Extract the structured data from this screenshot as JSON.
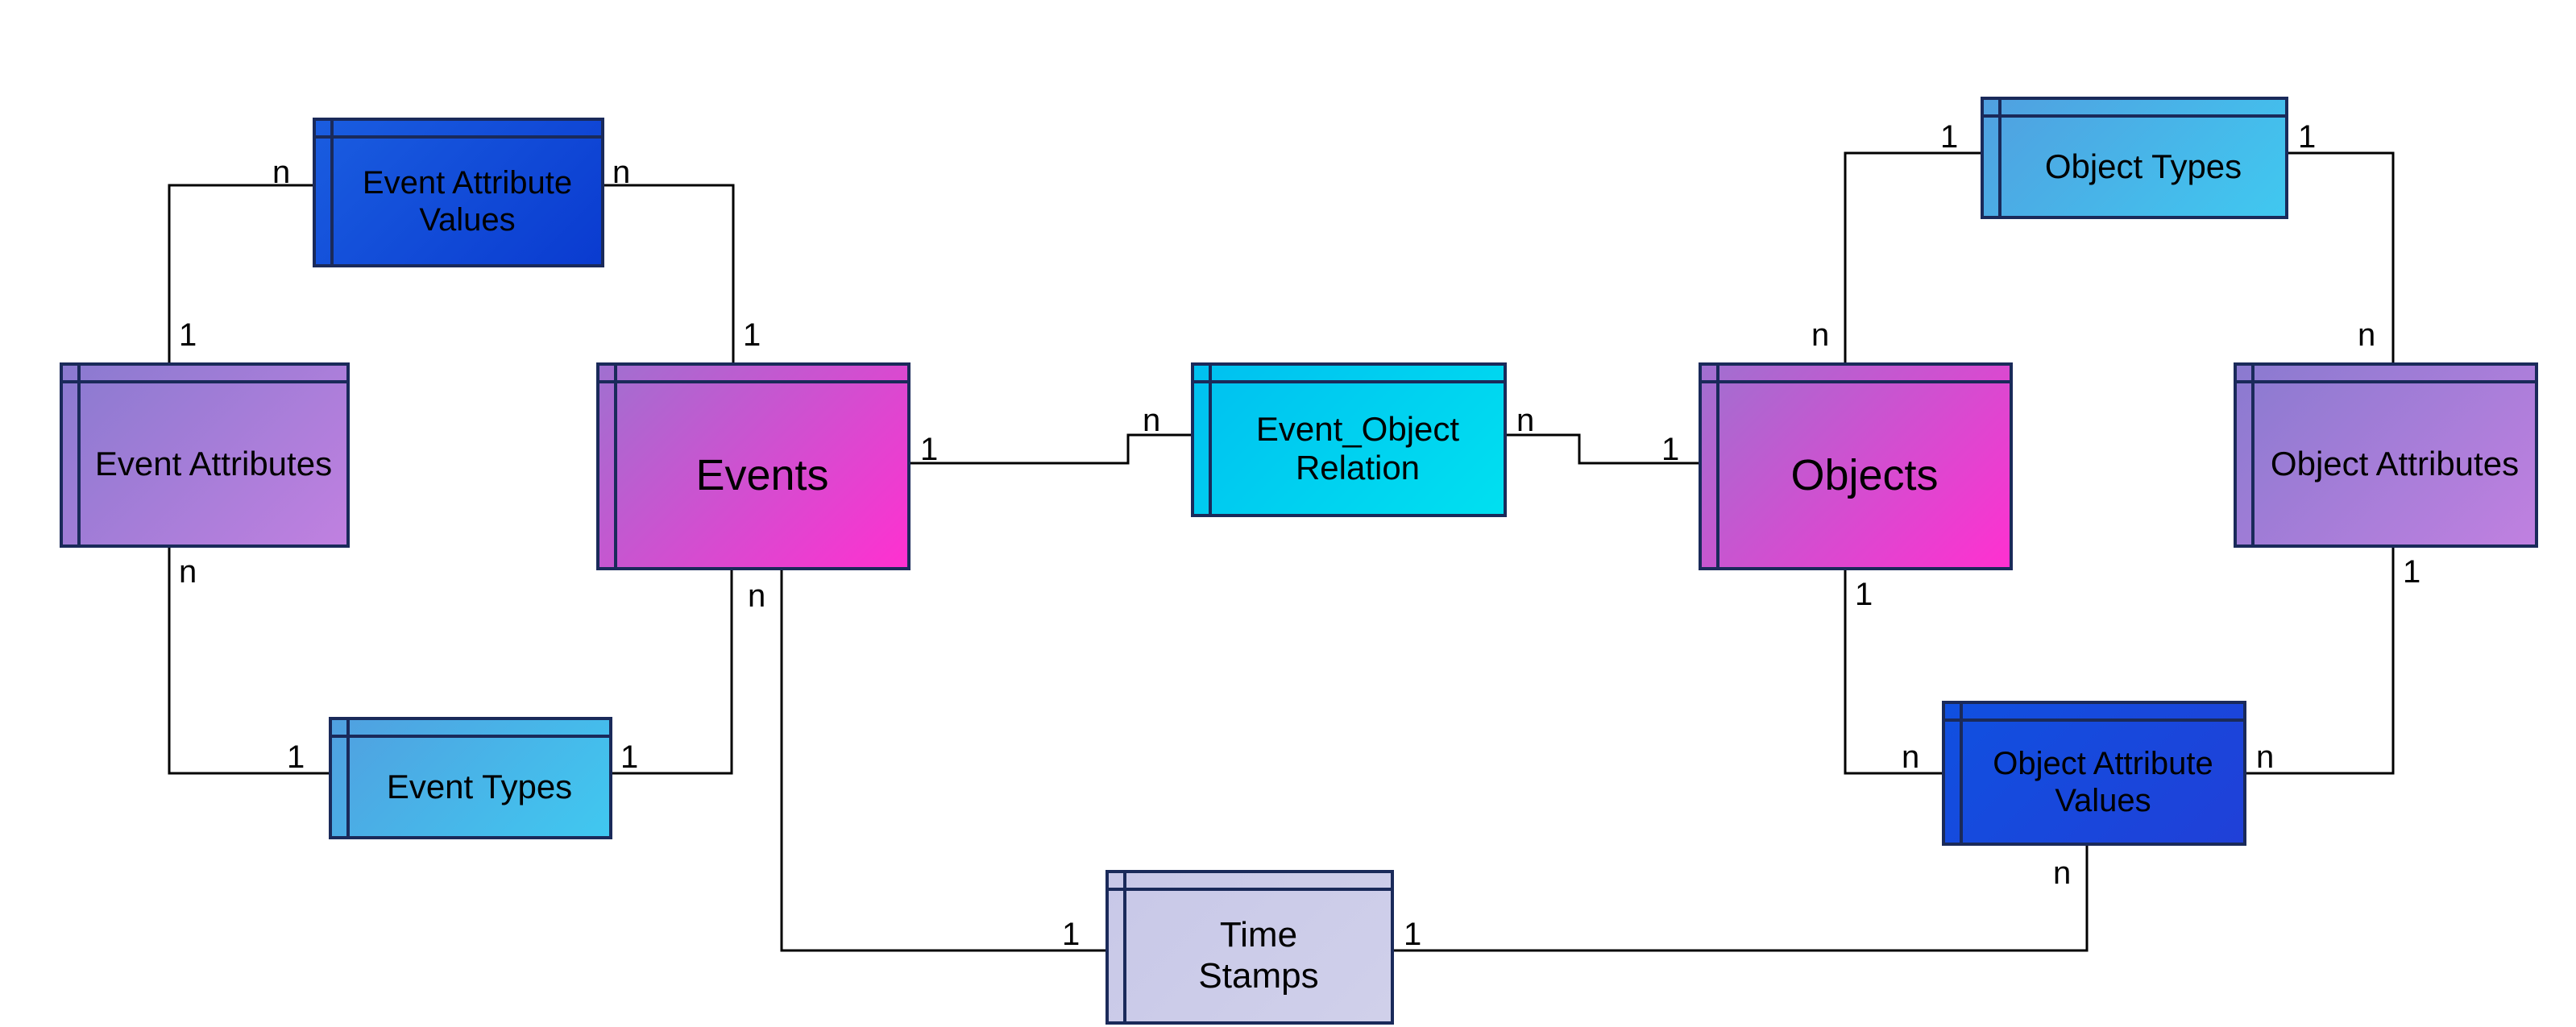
{
  "entities": {
    "event_attribute_values": {
      "label": "Event Attribute\nValues"
    },
    "event_attributes": {
      "label": "Event Attributes"
    },
    "events": {
      "label": "Events"
    },
    "event_types": {
      "label": "Event Types"
    },
    "event_object_relation": {
      "label": "Event_Object\nRelation"
    },
    "time_stamps": {
      "label": "Time\nStamps"
    },
    "objects": {
      "label": "Objects"
    },
    "object_types": {
      "label": "Object Types"
    },
    "object_attributes": {
      "label": "Object Attributes"
    },
    "object_attribute_values": {
      "label": "Object Attribute\nValues"
    }
  },
  "cardinalities": {
    "eav_left_n": "n",
    "eav_right_n": "n",
    "ea_top_1": "1",
    "ea_bottom_n": "n",
    "events_top_1": "1",
    "events_right_1": "1",
    "events_bottom_n": "n",
    "et_left_1": "1",
    "et_right_1": "1",
    "eor_left_n": "n",
    "eor_right_n": "n",
    "ts_left_1": "1",
    "ts_right_1": "1",
    "objects_left_1": "1",
    "objects_top_n": "n",
    "objects_bottom_1": "1",
    "ot_left_1": "1",
    "ot_right_1": "1",
    "oa_top_n": "n",
    "oa_bottom_1": "1",
    "oav_left_n": "n",
    "oav_right_n": "n",
    "oav_bottom_n": "n"
  },
  "colors": {
    "blue_dark": "linear-gradient(135deg,#1a5de0,#0a3bd0)",
    "purple": "linear-gradient(135deg,#8a7ad0,#c080e0)",
    "magenta": "linear-gradient(135deg,#a070d0,#ff30d0)",
    "cyan_light": "linear-gradient(135deg,#50a0e0,#40c8f0)",
    "cyan_bright": "linear-gradient(135deg,#00c0f0,#00e0f0)",
    "lavender": "linear-gradient(135deg,#c8c8e8,#d0d0ea)",
    "blue_darker": "linear-gradient(135deg,#1050e0,#2040d8)"
  }
}
